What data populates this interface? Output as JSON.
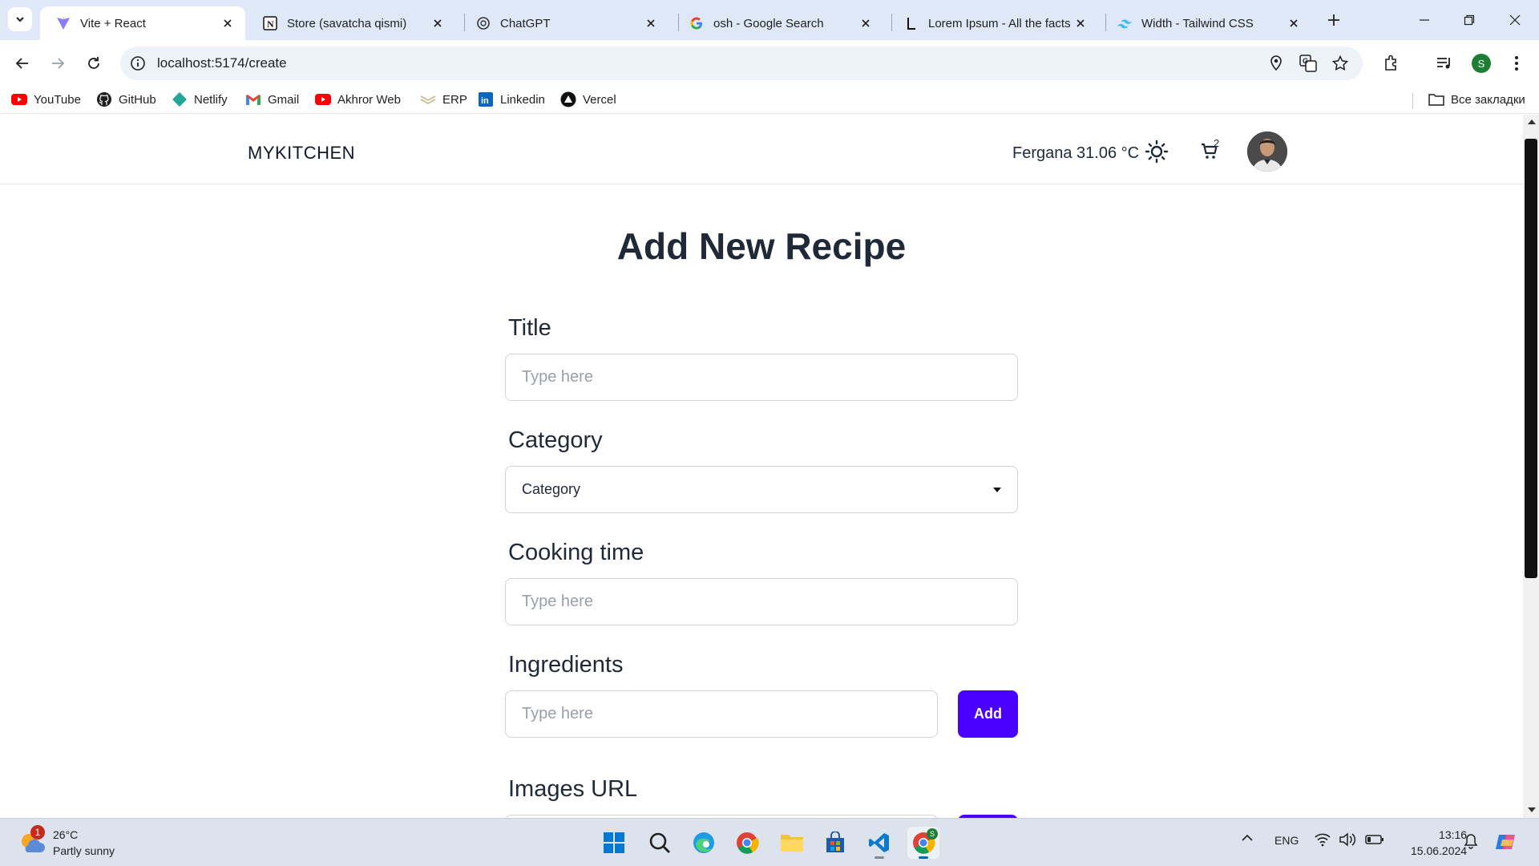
{
  "browser": {
    "tabs": [
      {
        "title": "Vite + React",
        "icon": "vite-icon",
        "active": true
      },
      {
        "title": "Store (savatcha qismi)",
        "icon": "notion-icon",
        "active": false
      },
      {
        "title": "ChatGPT",
        "icon": "openai-icon",
        "active": false
      },
      {
        "title": "osh - Google Search",
        "icon": "google-icon",
        "active": false
      },
      {
        "title": "Lorem Ipsum - All the facts",
        "icon": "lorem-ipsum-icon",
        "active": false
      },
      {
        "title": "Width - Tailwind CSS",
        "icon": "tailwind-icon",
        "active": false
      }
    ],
    "url": "localhost:5174/create",
    "profile_initial": "S",
    "bookmarks": [
      {
        "label": "YouTube",
        "icon": "youtube-icon"
      },
      {
        "label": "GitHub",
        "icon": "github-icon"
      },
      {
        "label": "Netlify",
        "icon": "netlify-icon"
      },
      {
        "label": "Gmail",
        "icon": "gmail-icon"
      },
      {
        "label": "Akhror Web",
        "icon": "youtube-icon"
      },
      {
        "label": "ERP",
        "icon": "erp-icon"
      },
      {
        "label": "Linkedin",
        "icon": "linkedin-icon"
      },
      {
        "label": "Vercel",
        "icon": "vercel-icon"
      }
    ],
    "all_bookmarks_label": "Все закладки"
  },
  "app": {
    "logo": "MYKITCHEN",
    "weather": "Fergana 31.06 °C",
    "cart_count": "2",
    "page_title": "Add New Recipe",
    "form": {
      "title_label": "Title",
      "title_placeholder": "Type here",
      "category_label": "Category",
      "category_selected": "Category",
      "cooking_time_label": "Cooking time",
      "cooking_time_placeholder": "Type here",
      "ingredients_label": "Ingredients",
      "ingredients_placeholder": "Type here",
      "add_label": "Add",
      "images_url_label": "Images URL"
    }
  },
  "taskbar": {
    "weather_badge": "1",
    "temperature": "26°C",
    "condition": "Partly sunny",
    "language": "ENG",
    "time": "13:16",
    "date": "15.06.2024",
    "chrome_profile_badge": "S"
  },
  "colors": {
    "accent": "#4a00ff",
    "tabstrip": "#dfe8f7",
    "taskbar": "#dde3ec"
  }
}
